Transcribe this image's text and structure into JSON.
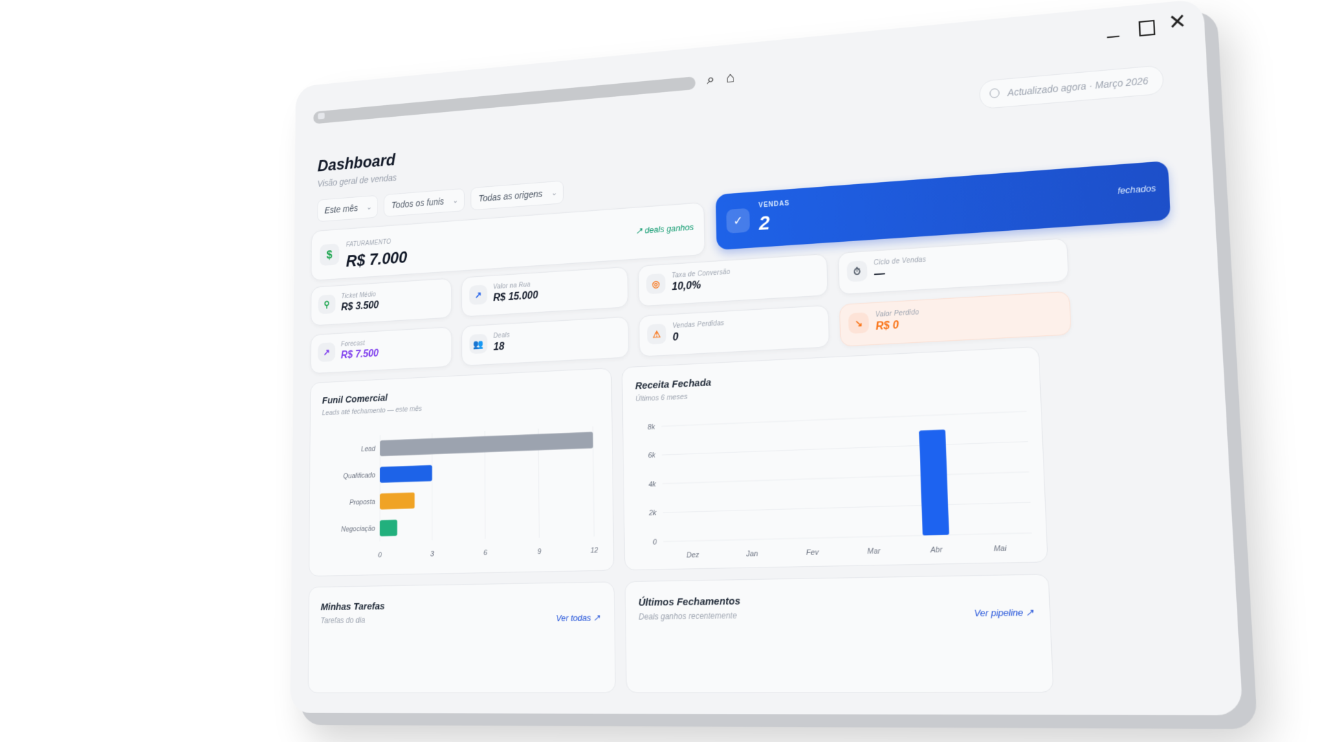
{
  "window": {
    "controls": {
      "minimize": "_",
      "close": "✕"
    }
  },
  "toolbar": {
    "search_icon": "search-icon",
    "home_icon": "home-icon"
  },
  "header": {
    "title": "Dashboard",
    "subtitle": "Visão geral de vendas",
    "updated": "Actualizado agora · Março 2026"
  },
  "filters": [
    {
      "label": "Este mês"
    },
    {
      "label": "Todos os funis"
    },
    {
      "label": "Todas as origens"
    }
  ],
  "kpis": {
    "faturamento": {
      "label": "Faturamento",
      "value": "R$ 7.000",
      "link": "↗ deals ganhos",
      "icon": "$",
      "color": "#16a34a"
    },
    "vendas": {
      "label": "Vendas",
      "value": "2",
      "suffix": "fechados",
      "icon": "✓"
    },
    "ticket": {
      "label": "Ticket Médio",
      "value": "R$ 3.500",
      "icon": "⚲"
    },
    "rua": {
      "label": "Valor na Rua",
      "value": "R$ 15.000",
      "icon": "↗"
    },
    "conversao": {
      "label": "Taxa de Conversão",
      "value": "10,0%",
      "icon": "◎"
    },
    "ciclo": {
      "label": "Ciclo de Vendas",
      "value": "—",
      "icon": "⏱"
    },
    "forecast": {
      "label": "Forecast",
      "value": "R$ 7.500",
      "icon": "↗",
      "color": "#7c3aed"
    },
    "deals": {
      "label": "Deals",
      "value": "18",
      "icon": "👥"
    },
    "perdidas": {
      "label": "Vendas Perdidas",
      "value": "0",
      "icon": "⚠"
    },
    "valor_perdido": {
      "label": "Valor Perdido",
      "value": "R$ 0",
      "icon": "↘",
      "color": "#f97316"
    }
  },
  "funil": {
    "title": "Funil Comercial",
    "subtitle": "Leads até fechamento — este mês"
  },
  "receita": {
    "title": "Receita Fechada",
    "subtitle": "Últimos 6 meses"
  },
  "tarefas": {
    "title": "Minhas Tarefas",
    "subtitle": "Tarefas do dia",
    "link": "Ver todas ↗"
  },
  "fechamentos": {
    "title": "Últimos Fechamentos",
    "subtitle": "Deals ganhos recentemente",
    "link": "Ver pipeline ↗"
  },
  "chart_data": [
    {
      "type": "bar",
      "orientation": "horizontal",
      "title": "Funil Comercial",
      "categories": [
        "Lead",
        "Qualificado",
        "Proposta",
        "Negociação"
      ],
      "values": [
        12,
        3,
        2,
        1
      ],
      "colors": [
        "#9ca3af",
        "#1d63e8",
        "#f0a325",
        "#22b07d"
      ],
      "xlim": [
        0,
        12
      ],
      "xticks": [
        "0",
        "3",
        "6",
        "9",
        "12"
      ],
      "grid": true
    },
    {
      "type": "bar",
      "title": "Receita Fechada",
      "categories": [
        "Dez",
        "Jan",
        "Fev",
        "Mar",
        "Abr",
        "Mai"
      ],
      "values": [
        0,
        0,
        0,
        0,
        7000,
        0
      ],
      "ylim": [
        0,
        8000
      ],
      "yticks": [
        "0",
        "2k",
        "4k",
        "6k",
        "8k"
      ],
      "color": "#1d63f0",
      "grid": true
    }
  ]
}
